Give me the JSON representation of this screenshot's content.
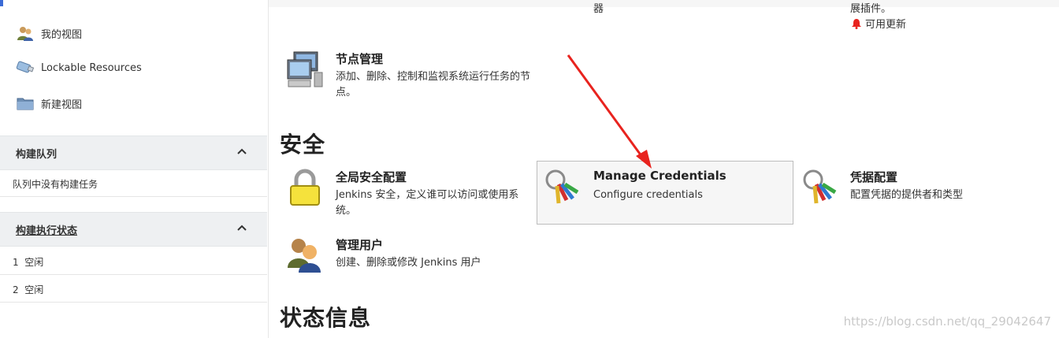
{
  "sidebar": {
    "items": [
      {
        "label": "我的视图",
        "icon": "people-icon"
      },
      {
        "label": "Lockable Resources",
        "icon": "usb-drive-icon"
      },
      {
        "label": "新建视图",
        "icon": "folder-icon"
      }
    ],
    "build_queue": {
      "title": "构建队列",
      "empty": "队列中没有构建任务"
    },
    "executors": {
      "title": "构建执行状态",
      "rows": [
        {
          "num": "1",
          "status": "空闲"
        },
        {
          "num": "2",
          "status": "空闲"
        }
      ]
    }
  },
  "main": {
    "top_fragment_left": "器",
    "top_fragment_right": "展插件。",
    "updates_label": "可用更新",
    "nodes": {
      "name": "节点管理",
      "desc": "添加、删除、控制和监视系统运行任务的节点。"
    },
    "security_title": "安全",
    "security_items": [
      {
        "name": "全局安全配置",
        "desc": "Jenkins 安全，定义谁可以访问或使用系统。"
      },
      {
        "name": "Manage Credentials",
        "desc": "Configure credentials"
      },
      {
        "name": "凭据配置",
        "desc": "配置凭据的提供者和类型"
      },
      {
        "name": "管理用户",
        "desc": "创建、删除或修改 Jenkins 用户"
      }
    ],
    "status_title": "状态信息",
    "watermark": "https://blog.csdn.net/qq_29042647"
  },
  "colors": {
    "arrow": "#e8231e",
    "bell": "#e8231e",
    "highlight_border": "#bdbdbd"
  }
}
